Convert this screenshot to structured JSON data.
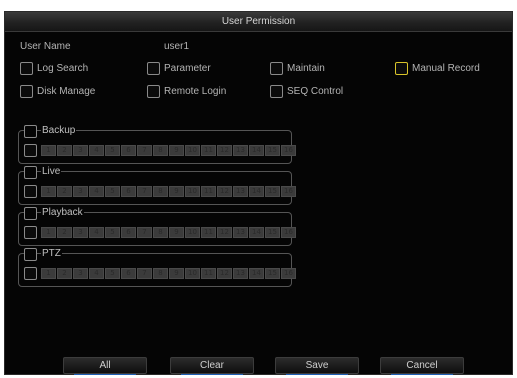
{
  "dialog": {
    "title": "User Permission"
  },
  "user": {
    "label": "User Name",
    "value": "user1"
  },
  "permissions": [
    {
      "label": "Log Search",
      "checked": false,
      "highlighted": false
    },
    {
      "label": "Parameter",
      "checked": false,
      "highlighted": false
    },
    {
      "label": "Maintain",
      "checked": false,
      "highlighted": false
    },
    {
      "label": "Manual Record",
      "checked": false,
      "highlighted": true
    },
    {
      "label": "Disk Manage",
      "checked": false,
      "highlighted": false
    },
    {
      "label": "Remote Login",
      "checked": false,
      "highlighted": false
    },
    {
      "label": "SEQ Control",
      "checked": false,
      "highlighted": false
    }
  ],
  "channel_groups": [
    {
      "label": "Backup"
    },
    {
      "label": "Live"
    },
    {
      "label": "Playback"
    },
    {
      "label": "PTZ"
    }
  ],
  "channels": [
    "1",
    "2",
    "3",
    "4",
    "5",
    "6",
    "7",
    "8",
    "9",
    "10",
    "11",
    "12",
    "13",
    "14",
    "15",
    "16"
  ],
  "buttons": {
    "all": "All",
    "clear": "Clear",
    "save": "Save",
    "cancel": "Cancel"
  },
  "colors": {
    "highlight": "#d9c42a",
    "button_underline": "#1f5fb5",
    "background": "#050505"
  }
}
